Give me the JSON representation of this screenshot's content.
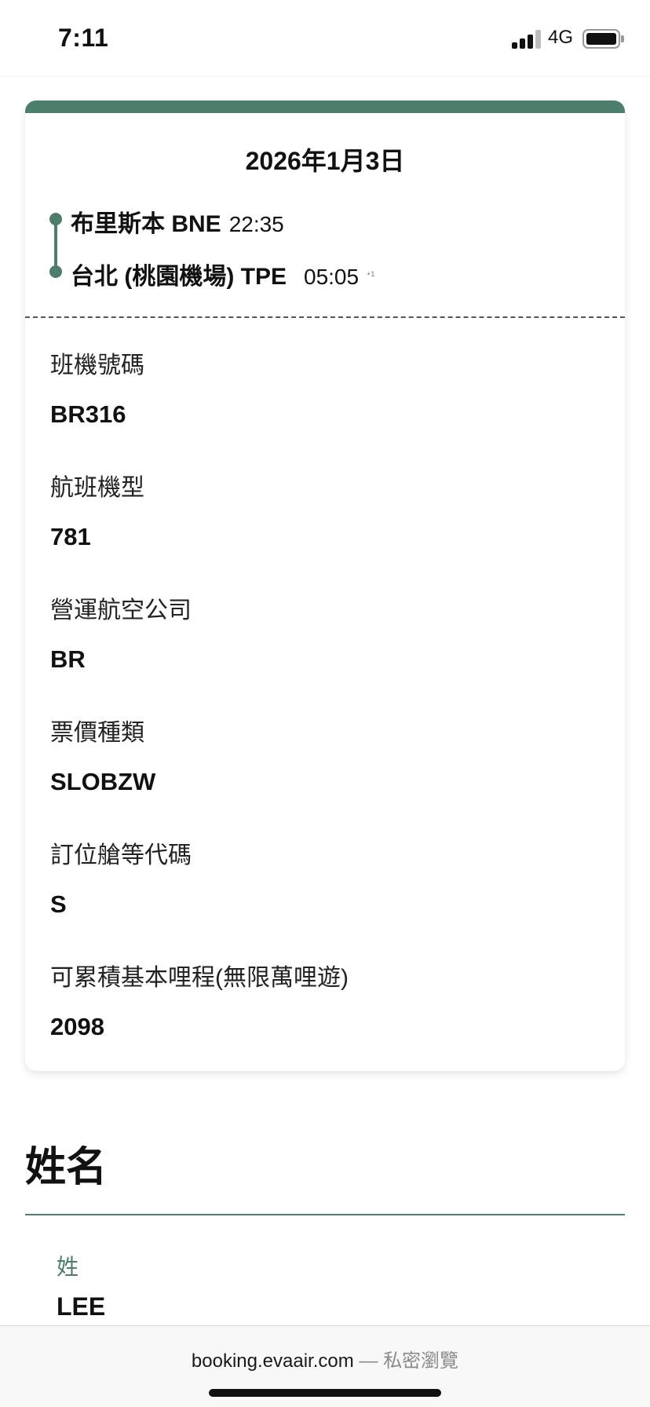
{
  "status_bar": {
    "time": "7:11",
    "network": "4G"
  },
  "flight": {
    "date": "2026年1月3日",
    "departure": {
      "city": "布里斯本 BNE",
      "time": "22:35"
    },
    "arrival": {
      "city": "台北 (桃園機場) TPE",
      "time": "05:05",
      "mark": "+1"
    },
    "details": [
      {
        "label": "班機號碼",
        "value": "BR316"
      },
      {
        "label": "航班機型",
        "value": "781"
      },
      {
        "label": "營運航空公司",
        "value": "BR"
      },
      {
        "label": "票價種類",
        "value": "SLOBZW"
      },
      {
        "label": "訂位艙等代碼",
        "value": "S"
      },
      {
        "label": "可累積基本哩程(無限萬哩遊)",
        "value": "2098"
      }
    ]
  },
  "name_section": {
    "heading": "姓名",
    "surname_label": "姓",
    "surname_value": "LEE"
  },
  "browser": {
    "domain": "booking.evaair.com",
    "separator": " — ",
    "mode": "私密瀏覽"
  },
  "colors": {
    "accent": "#4d7d6b"
  }
}
